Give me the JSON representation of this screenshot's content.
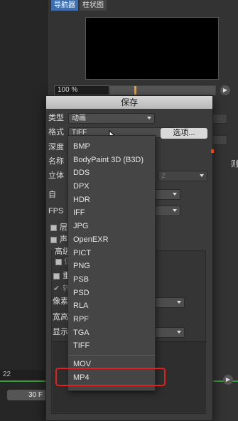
{
  "tabs": [
    {
      "label": "导航器",
      "active": true
    },
    {
      "label": "柱状图",
      "active": false
    }
  ],
  "zoom": {
    "value": "100 %"
  },
  "timeline": {
    "frame_label": "22",
    "frame_field": "30 F"
  },
  "right_edge_letter": "则",
  "dialog": {
    "title": "保存",
    "type_label": "类型",
    "type_value": "动画",
    "format_label": "格式",
    "format_value": "TIFF",
    "options_button": "选项...",
    "depth_label": "深度",
    "name_label": "名称",
    "stereo_label": "立体",
    "stereo_value": "2",
    "auto_label": "自",
    "fps_label": "FPS",
    "layer_label": "层",
    "sound_label": "声",
    "advanced_label": "高级",
    "save_label": "保",
    "resample_label": "重",
    "check_label": "转",
    "pixel_label": "像素",
    "aspect_label": "宽高",
    "display_label": "显示"
  },
  "format_menu": {
    "items": [
      "BMP",
      "BodyPaint 3D (B3D)",
      "DDS",
      "DPX",
      "HDR",
      "IFF",
      "JPG",
      "OpenEXR",
      "PICT",
      "PNG",
      "PSB",
      "PSD",
      "RLA",
      "RPF",
      "TGA",
      "TIFF"
    ],
    "video_items": [
      "MOV",
      "MP4"
    ],
    "highlighted": "MP4",
    "highlight_color": "#e02020"
  },
  "colors": {
    "accent_tab": "#3d6fb0",
    "zoom_knob": "#f0a020",
    "timeline": "#3a9a3a"
  }
}
